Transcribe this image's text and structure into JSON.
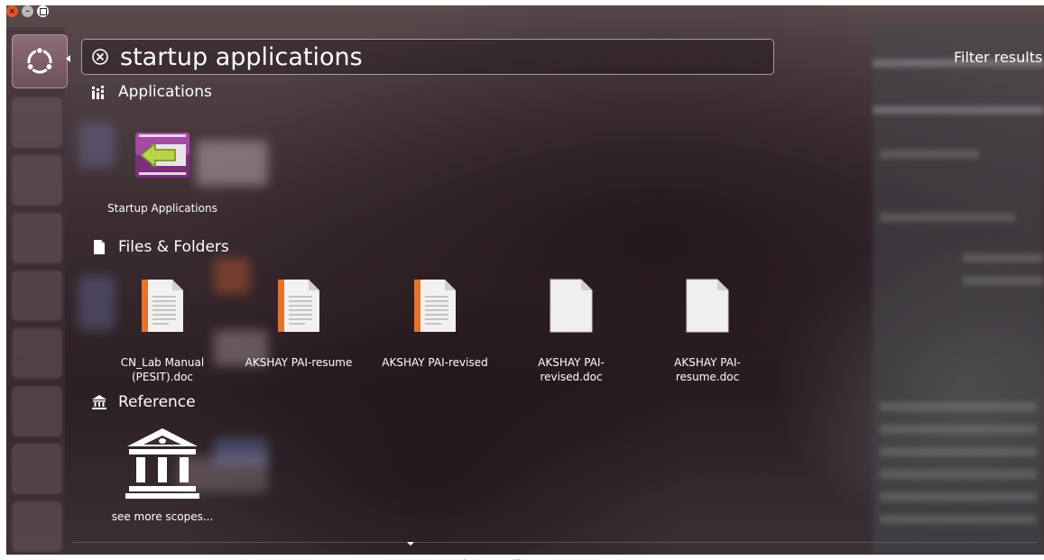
{
  "window": {
    "controls": [
      "close",
      "minimize",
      "maximize"
    ]
  },
  "search": {
    "query": "startup applications",
    "filter_label": "Filter results"
  },
  "categories": {
    "applications": "Applications",
    "files": "Files & Folders",
    "reference": "Reference"
  },
  "applications": [
    {
      "name": "Startup Applications",
      "icon": "startup-applications-icon"
    }
  ],
  "files": [
    {
      "line1": "CN_Lab Manual",
      "line2": "(PESIT).doc",
      "icon": "document-icon"
    },
    {
      "line1": "AKSHAY PAI-resume",
      "line2": "",
      "icon": "document-icon"
    },
    {
      "line1": "AKSHAY PAI-revised",
      "line2": "",
      "icon": "document-icon"
    },
    {
      "line1": "AKSHAY PAI-",
      "line2": "revised.doc",
      "icon": "blank-document-icon"
    },
    {
      "line1": "AKSHAY PAI-",
      "line2": "resume.doc",
      "icon": "blank-document-icon"
    }
  ],
  "reference": [
    {
      "name": "see more scopes...",
      "icon": "scopes-building-icon"
    }
  ],
  "colors": {
    "close": "#e9542c",
    "doc_accent": "#e5732d",
    "startup_purple": "#9a3f9a",
    "startup_arrow": "#b8d44a"
  }
}
